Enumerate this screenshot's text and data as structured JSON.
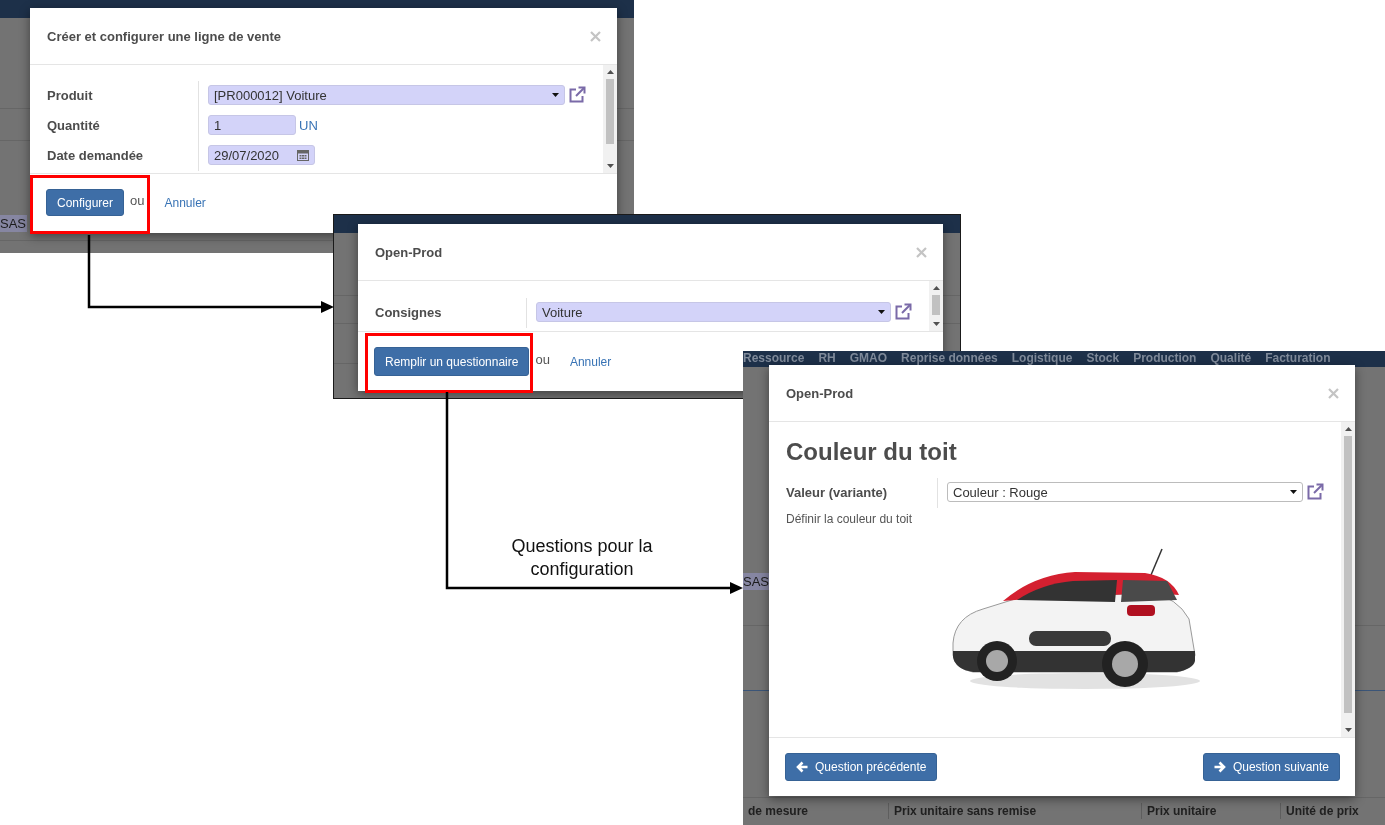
{
  "screens": [
    {
      "background": {
        "fragments": [
          {
            "text": "SAS",
            "kind": "chip"
          }
        ]
      },
      "dialog": {
        "title": "Créer et configurer une ligne de vente",
        "fields": [
          {
            "label": "Produit",
            "kind": "select",
            "value": "[PR000012] Voiture",
            "required": true,
            "external_link": true
          },
          {
            "label": "Quantité",
            "kind": "number",
            "value": "1",
            "unit": "UN",
            "required": true
          },
          {
            "label": "Date demandée",
            "kind": "date",
            "value": "29/07/2020",
            "required": true
          }
        ],
        "footer": {
          "buttons": [
            {
              "label": "Configurer",
              "kind": "primary",
              "highlighted": true
            }
          ],
          "separator": "ou",
          "cancel": "Annuler"
        }
      }
    },
    {
      "dialog": {
        "title": "Open-Prod",
        "fields": [
          {
            "label": "Consignes",
            "kind": "select",
            "value": "Voiture",
            "required": true,
            "external_link": true
          }
        ],
        "footer": {
          "buttons": [
            {
              "label": "Remplir un questionnaire",
              "kind": "primary",
              "highlighted": true
            }
          ],
          "separator": "ou",
          "cancel": "Annuler"
        }
      }
    },
    {
      "background": {
        "menu": [
          "Ressource",
          "RH",
          "GMAO",
          "Reprise données",
          "Logistique",
          "Stock",
          "Production",
          "Qualité",
          "Facturation"
        ],
        "fragments": [
          {
            "text": "SAS",
            "kind": "chip"
          }
        ],
        "columns": [
          "de mesure",
          "Prix unitaire sans remise",
          "Prix unitaire",
          "Unité de prix"
        ]
      },
      "dialog": {
        "title": "Open-Prod",
        "heading": "Couleur du toit",
        "fields": [
          {
            "label": "Valeur (variante)",
            "kind": "select",
            "value": "Couleur : Rouge",
            "required": false,
            "external_link": true
          }
        ],
        "help": "Définir la couleur du toit",
        "photo": true,
        "footer": {
          "buttons": [
            {
              "label": "Question précédente",
              "kind": "back",
              "highlighted": false
            },
            {
              "label": "Question suivante",
              "kind": "forward",
              "highlighted": false
            }
          ]
        }
      }
    }
  ],
  "annotations": [
    "Questions pour la configuration"
  ]
}
